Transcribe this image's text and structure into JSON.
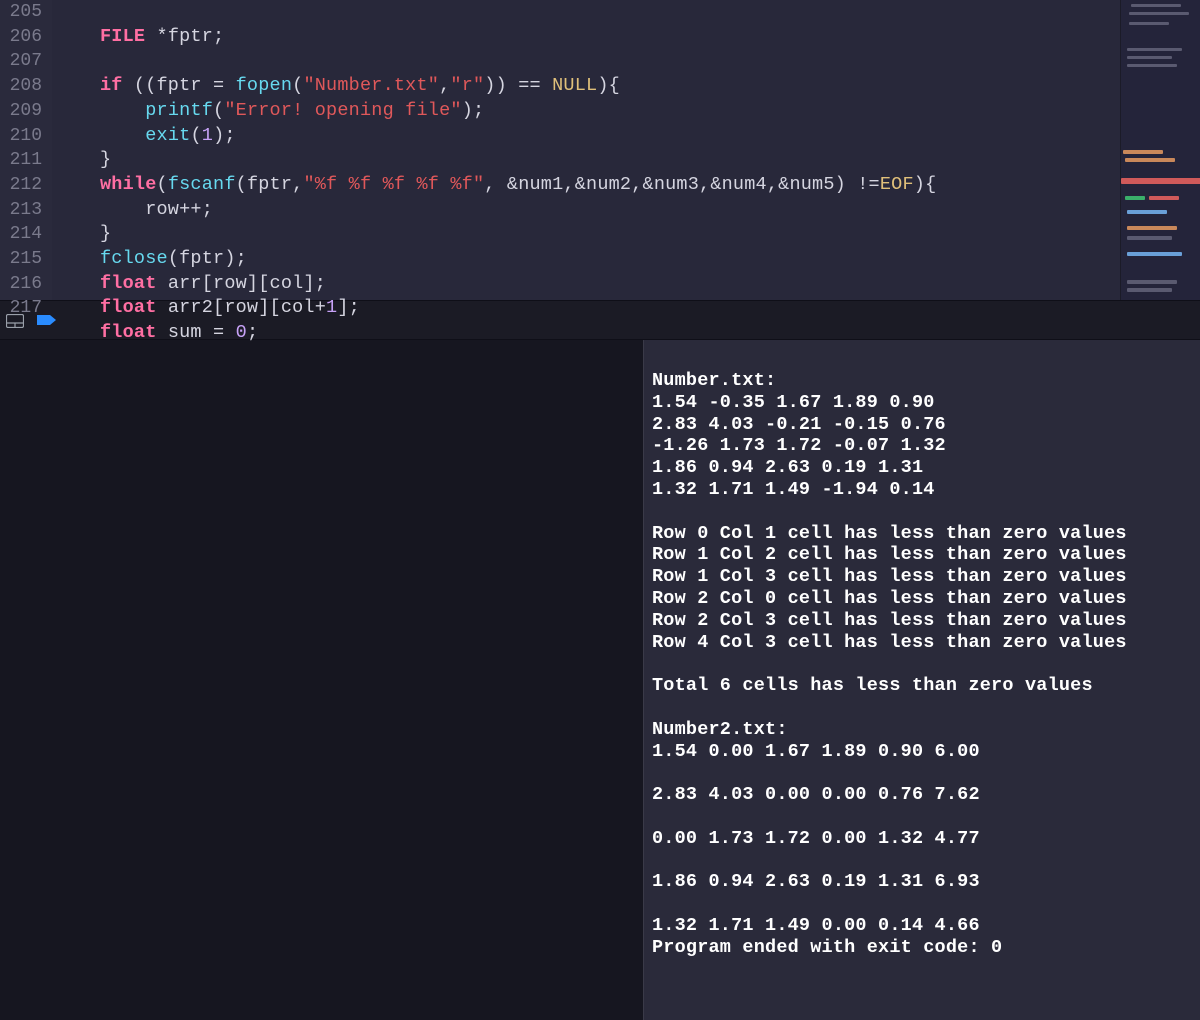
{
  "gutter": {
    "start": 205,
    "lines": [
      "205",
      "206",
      "207",
      "208",
      "209",
      "210",
      "211",
      "212",
      "213",
      "214",
      "215",
      "216",
      "217"
    ]
  },
  "code": {
    "line205": {
      "a": "FILE ",
      "b": "*fptr;"
    },
    "line207": {
      "a": "if ",
      "b": "((fptr = ",
      "c": "fopen",
      "d": "(",
      "e": "\"Number.txt\"",
      "f": ",",
      "g": "\"r\"",
      "h": ")) == ",
      "i": "NULL",
      "j": "){"
    },
    "line208": {
      "a": "    ",
      "b": "printf",
      "c": "(",
      "d": "\"Error! opening file\"",
      "e": ");"
    },
    "line209": {
      "a": "    ",
      "b": "exit",
      "c": "(",
      "d": "1",
      "e": ");"
    },
    "line210": {
      "a": "}"
    },
    "line211": {
      "a": "while",
      "b": "(",
      "c": "fscanf",
      "d": "(fptr,",
      "e": "\"%f %f %f %f %f\"",
      "f": ", &num1,&num2,&num3,&num4,&num5) !=",
      "g": "EOF",
      "h": "){"
    },
    "line212": {
      "a": "    row++;"
    },
    "line213": {
      "a": "}"
    },
    "line214": {
      "a": "fclose",
      "b": "(fptr);"
    },
    "line215": {
      "a": "float ",
      "b": "arr[row][col];"
    },
    "line216": {
      "a": "float ",
      "b": "arr2[row][col+",
      "c": "1",
      "d": "];"
    },
    "line217": {
      "a": "float ",
      "b": "sum = ",
      "c": "0",
      "d": ";"
    }
  },
  "console": {
    "header1": "Number.txt:",
    "rows1": [
      "1.54 -0.35 1.67 1.89 0.90",
      "2.83 4.03 -0.21 -0.15 0.76",
      "-1.26 1.73 1.72 -0.07 1.32",
      "1.86 0.94 2.63 0.19 1.31",
      "1.32 1.71 1.49 -1.94 0.14"
    ],
    "msgs": [
      "Row 0 Col 1 cell has less than zero values",
      "Row 1 Col 2 cell has less than zero values",
      "Row 1 Col 3 cell has less than zero values",
      "Row 2 Col 0 cell has less than zero values",
      "Row 2 Col 3 cell has less than zero values",
      "Row 4 Col 3 cell has less than zero values"
    ],
    "total": "Total 6 cells has less than zero values",
    "header2": "Number2.txt:",
    "rows2": [
      "1.54 0.00 1.67 1.89 0.90 6.00",
      "2.83 4.03 0.00 0.00 0.76 7.62",
      "0.00 1.73 1.72 0.00 1.32 4.77",
      "1.86 0.94 2.63 0.19 1.31 6.93",
      "1.32 1.71 1.49 0.00 0.14 4.66"
    ],
    "exit": "Program ended with exit code: 0"
  },
  "icons": {
    "panel": "panel-layout-icon",
    "breakpoint": "breakpoint-arrow-icon"
  }
}
